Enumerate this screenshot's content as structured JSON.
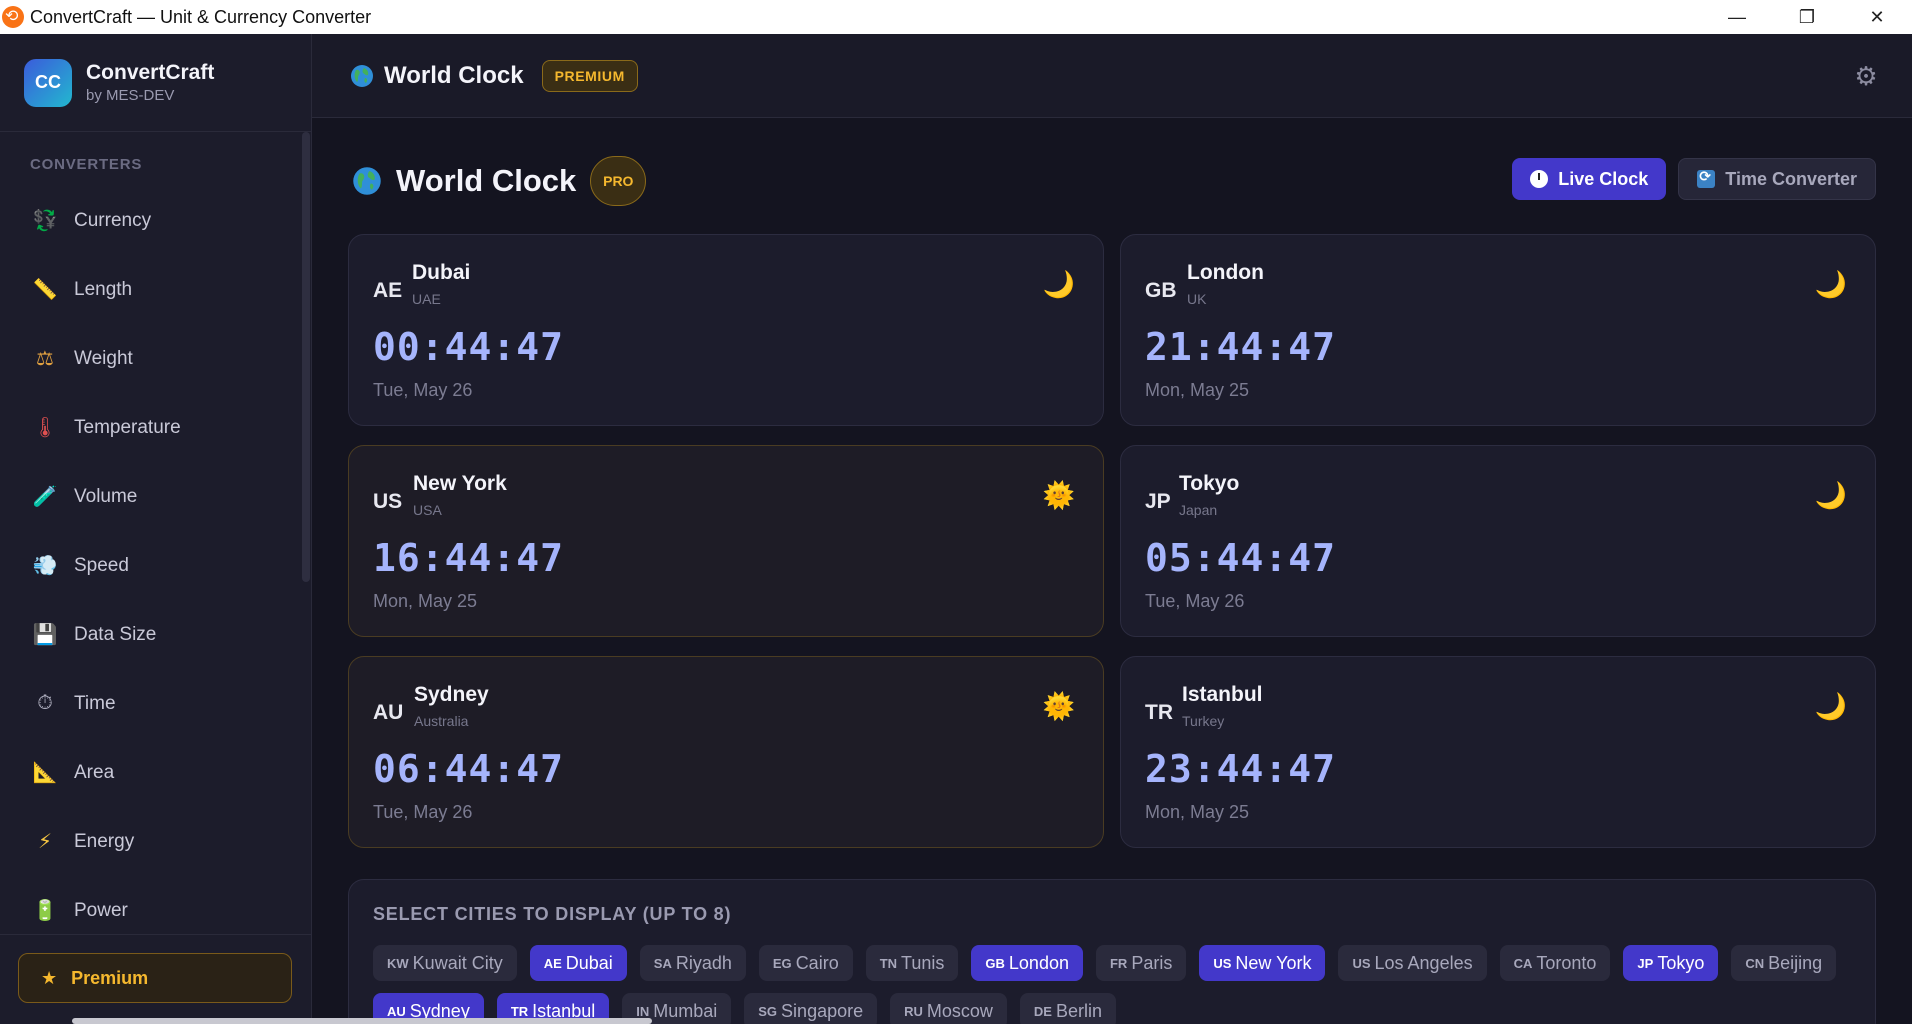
{
  "window": {
    "title": "ConvertCraft — Unit & Currency Converter",
    "minimize": "—",
    "restore": "❐",
    "close": "✕"
  },
  "brand": {
    "logo": "CC",
    "name": "ConvertCraft",
    "sub": "by MES-DEV"
  },
  "sidebar": {
    "heading": "CONVERTERS",
    "items": [
      {
        "label": "Currency",
        "icon": "currency-exchange-icon"
      },
      {
        "label": "Length",
        "icon": "ruler-icon"
      },
      {
        "label": "Weight",
        "icon": "scales-icon"
      },
      {
        "label": "Temperature",
        "icon": "thermometer-icon"
      },
      {
        "label": "Volume",
        "icon": "test-tube-icon"
      },
      {
        "label": "Speed",
        "icon": "wind-icon"
      },
      {
        "label": "Data Size",
        "icon": "floppy-disk-icon"
      },
      {
        "label": "Time",
        "icon": "stopwatch-icon"
      },
      {
        "label": "Area",
        "icon": "triangle-ruler-icon"
      },
      {
        "label": "Energy",
        "icon": "lightning-icon"
      },
      {
        "label": "Power",
        "icon": "battery-icon"
      }
    ],
    "premium_label": "Premium"
  },
  "topbar": {
    "title": "World Clock",
    "badge": "PREMIUM"
  },
  "main": {
    "title": "World Clock",
    "badge": "PRO",
    "tabs": {
      "live": "Live Clock",
      "converter": "Time Converter"
    }
  },
  "clocks": [
    {
      "code": "AE",
      "city": "Dubai",
      "country": "UAE",
      "time": "00:44:47",
      "date": "Tue, May 26",
      "phase": "night"
    },
    {
      "code": "GB",
      "city": "London",
      "country": "UK",
      "time": "21:44:47",
      "date": "Mon, May 25",
      "phase": "night"
    },
    {
      "code": "US",
      "city": "New York",
      "country": "USA",
      "time": "16:44:47",
      "date": "Mon, May 25",
      "phase": "day"
    },
    {
      "code": "JP",
      "city": "Tokyo",
      "country": "Japan",
      "time": "05:44:47",
      "date": "Tue, May 26",
      "phase": "night"
    },
    {
      "code": "AU",
      "city": "Sydney",
      "country": "Australia",
      "time": "06:44:47",
      "date": "Tue, May 26",
      "phase": "day"
    },
    {
      "code": "TR",
      "city": "Istanbul",
      "country": "Turkey",
      "time": "23:44:47",
      "date": "Mon, May 25",
      "phase": "night"
    }
  ],
  "selector": {
    "heading": "SELECT CITIES TO DISPLAY (UP TO 8)",
    "chips": [
      {
        "code": "KW",
        "label": "Kuwait City",
        "selected": false
      },
      {
        "code": "AE",
        "label": "Dubai",
        "selected": true
      },
      {
        "code": "SA",
        "label": "Riyadh",
        "selected": false
      },
      {
        "code": "EG",
        "label": "Cairo",
        "selected": false
      },
      {
        "code": "TN",
        "label": "Tunis",
        "selected": false
      },
      {
        "code": "GB",
        "label": "London",
        "selected": true
      },
      {
        "code": "FR",
        "label": "Paris",
        "selected": false
      },
      {
        "code": "US",
        "label": "New York",
        "selected": true
      },
      {
        "code": "US",
        "label": "Los Angeles",
        "selected": false
      },
      {
        "code": "CA",
        "label": "Toronto",
        "selected": false
      },
      {
        "code": "JP",
        "label": "Tokyo",
        "selected": true
      },
      {
        "code": "CN",
        "label": "Beijing",
        "selected": false
      },
      {
        "code": "AU",
        "label": "Sydney",
        "selected": true
      },
      {
        "code": "TR",
        "label": "Istanbul",
        "selected": true
      },
      {
        "code": "IN",
        "label": "Mumbai",
        "selected": false
      },
      {
        "code": "SG",
        "label": "Singapore",
        "selected": false
      },
      {
        "code": "RU",
        "label": "Moscow",
        "selected": false
      },
      {
        "code": "DE",
        "label": "Berlin",
        "selected": false
      }
    ]
  },
  "colors": {
    "accent": "#4338ca",
    "gold": "#f5b82e",
    "time": "#a5b4fc"
  }
}
